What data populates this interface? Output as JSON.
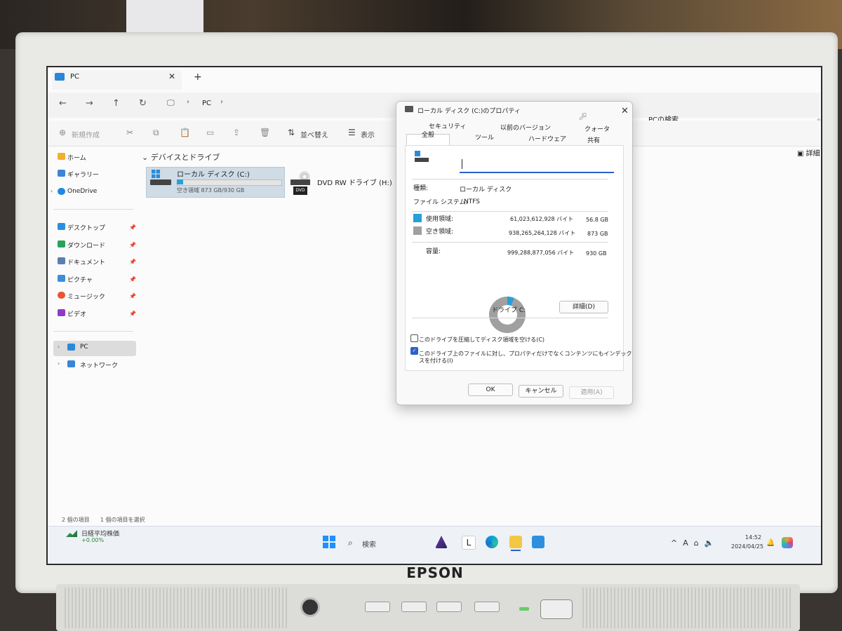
{
  "explorer": {
    "tab_title": "PC",
    "address": "PC",
    "search_label": "PCの検索",
    "toolbar": {
      "new_label": "新規作成",
      "sort_label": "並べ替え",
      "view_label": "表示",
      "details_label": "詳細"
    },
    "sidebar": {
      "home": "ホーム",
      "gallery": "ギャラリー",
      "onedrive": "OneDrive",
      "desktop": "デスクトップ",
      "downloads": "ダウンロード",
      "documents": "ドキュメント",
      "pictures": "ピクチャ",
      "music": "ミュージック",
      "videos": "ビデオ",
      "pc": "PC",
      "network": "ネットワーク"
    },
    "section_header": "デバイスとドライブ",
    "drives": [
      {
        "name": "ローカル ディスク (C:)",
        "space": "空き領域 873 GB/930 GB",
        "used_fraction": 0.06
      },
      {
        "name": "DVD RW ドライブ (H:)"
      }
    ],
    "status": {
      "item_count": "2 個の項目",
      "selected": "1 個の項目を選択"
    }
  },
  "taskbar": {
    "weather_title": "日経平均株価",
    "weather_sub": "+0.00%",
    "search_label": "検索",
    "clock_time": "14:52",
    "clock_date": "2024/04/25"
  },
  "dialog": {
    "title": "ローカル ディスク (C:)のプロパティ",
    "tabs_row1": [
      "セキュリティ",
      "以前のバージョン",
      "クォータ"
    ],
    "tabs_row2": [
      "全般",
      "ツール",
      "ハードウェア",
      "共有"
    ],
    "type_label": "種類:",
    "type_value": "ローカル ディスク",
    "fs_label": "ファイル システム:",
    "fs_value": "NTFS",
    "used_label": "使用領域:",
    "used_bytes": "61,023,612,928 バイト",
    "used_gb": "56.8 GB",
    "free_label": "空き領域:",
    "free_bytes": "938,265,264,128 バイト",
    "free_gb": "873 GB",
    "capacity_label": "容量:",
    "capacity_bytes": "999,288,877,056 バイト",
    "capacity_gb": "930 GB",
    "used_fraction": 0.061,
    "drive_label": "ドライブ C:",
    "details_button": "詳細(D)",
    "compress_label": "このドライブを圧縮してディスク領域を空ける(C)",
    "compress_checked": false,
    "index_label_line1": "このドライブ上のファイルに対し、プロパティだけでなくコンテンツにもインデック",
    "index_label_line2": "スを付ける(I)",
    "index_checked": true,
    "ok": "OK",
    "cancel": "キャンセル",
    "apply": "適用(A)",
    "colors": {
      "used": "#26a0da",
      "free": "#a0a0a0"
    }
  },
  "monitor": {
    "brand": "EPSON"
  }
}
